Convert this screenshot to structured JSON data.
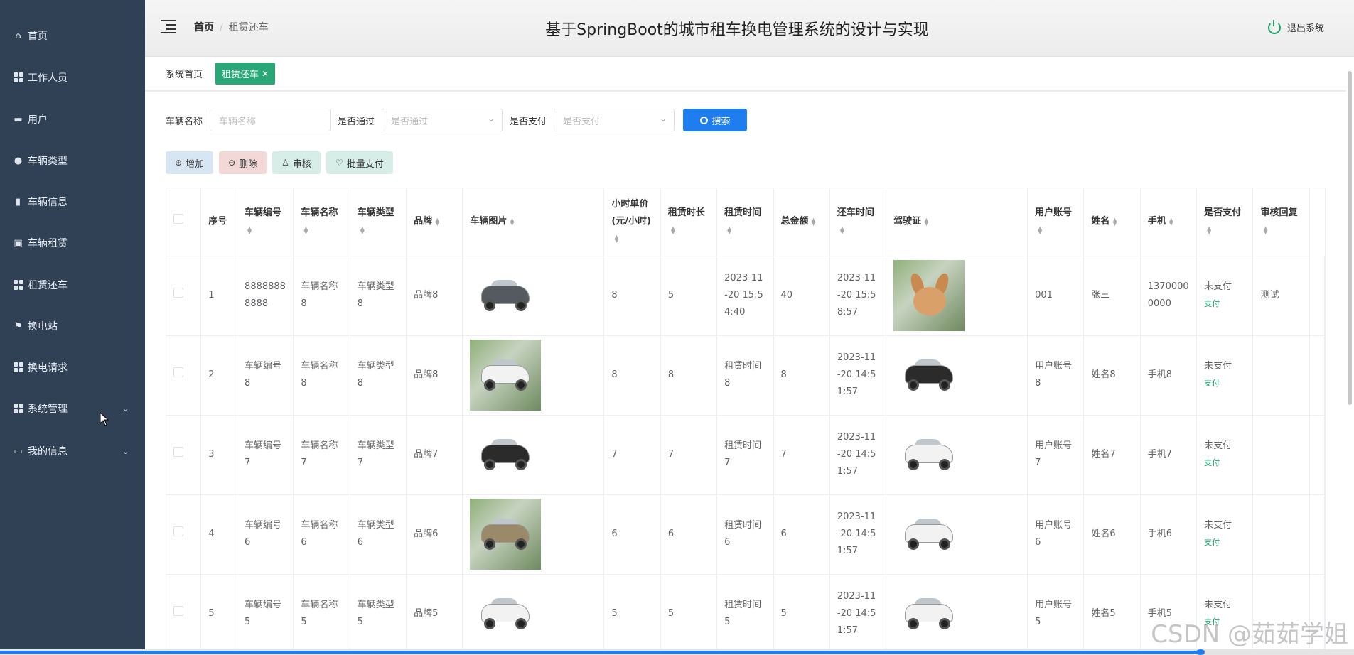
{
  "sidebar": {
    "items": [
      {
        "label": "首页",
        "icon": "home-icon"
      },
      {
        "label": "工作人员",
        "icon": "grid-icon"
      },
      {
        "label": "用户",
        "icon": "monitor-icon"
      },
      {
        "label": "车辆类型",
        "icon": "location-icon"
      },
      {
        "label": "车辆信息",
        "icon": "bar-chart-icon"
      },
      {
        "label": "车辆租赁",
        "icon": "clipboard-icon"
      },
      {
        "label": "租赁还车",
        "icon": "grid-icon"
      },
      {
        "label": "换电站",
        "icon": "flag-icon"
      },
      {
        "label": "换电请求",
        "icon": "grid-icon"
      },
      {
        "label": "系统管理",
        "icon": "grid-icon",
        "has_children": true
      },
      {
        "label": "我的信息",
        "icon": "id-card-icon",
        "has_children": true
      }
    ]
  },
  "header": {
    "breadcrumb": {
      "home": "首页",
      "separator": "/",
      "current": "租赁还车"
    },
    "title": "基于SpringBoot的城市租车换电管理系统的设计与实现",
    "logout": "退出系统"
  },
  "tags": {
    "home": "系统首页",
    "active": "租赁还车",
    "close": "✕"
  },
  "search": {
    "name_label": "车辆名称",
    "name_placeholder": "车辆名称",
    "pass_label": "是否通过",
    "pass_placeholder": "是否通过",
    "pay_label": "是否支付",
    "pay_placeholder": "是否支付",
    "button": "搜索"
  },
  "actions": {
    "add": "增加",
    "delete": "删除",
    "audit": "审核",
    "batch_pay": "批量支付"
  },
  "table": {
    "headers": [
      "序号",
      "车辆编号",
      "车辆名称",
      "车辆类型",
      "品牌",
      "车辆图片",
      "小时单价(元/小时)",
      "租赁时长",
      "租赁时间",
      "总金额",
      "还车时间",
      "驾驶证",
      "用户账号",
      "姓名",
      "手机",
      "是否支付",
      "审核回复"
    ],
    "rows": [
      {
        "index": "1",
        "vehicle_no": "88888888888",
        "vehicle_name": "车辆名称8",
        "vehicle_type": "车辆类型8",
        "brand": "品牌8",
        "image": "grey-car-image",
        "price": "8",
        "duration": "5",
        "rent_time": "2023-11-20 15:54:40",
        "total": "40",
        "return_time": "2023-11-20 15:58:57",
        "license": "rabbit-image",
        "account": "001",
        "name": "张三",
        "phone": "13700000000",
        "paid": "未支付",
        "pay_link": "支付",
        "reply": "测试"
      },
      {
        "index": "2",
        "vehicle_no": "车辆编号8",
        "vehicle_name": "车辆名称8",
        "vehicle_type": "车辆类型8",
        "brand": "品牌8",
        "image": "white-van-image",
        "price": "8",
        "duration": "8",
        "rent_time": "租赁时间8",
        "total": "8",
        "return_time": "2023-11-20 14:51:57",
        "license": "black-toy-car-image",
        "account": "用户账号8",
        "name": "姓名8",
        "phone": "手机8",
        "paid": "未支付",
        "pay_link": "支付",
        "reply": ""
      },
      {
        "index": "3",
        "vehicle_no": "车辆编号7",
        "vehicle_name": "车辆名称7",
        "vehicle_type": "车辆类型7",
        "brand": "品牌7",
        "image": "black-toy-car-image",
        "price": "7",
        "duration": "7",
        "rent_time": "租赁时间7",
        "total": "7",
        "return_time": "2023-11-20 14:51:57",
        "license": "white-mini-car-image",
        "account": "用户账号7",
        "name": "姓名7",
        "phone": "手机7",
        "paid": "未支付",
        "pay_link": "支付",
        "reply": ""
      },
      {
        "index": "4",
        "vehicle_no": "车辆编号6",
        "vehicle_name": "车辆名称6",
        "vehicle_type": "车辆类型6",
        "brand": "品牌6",
        "image": "gold-mini-car-image",
        "price": "6",
        "duration": "6",
        "rent_time": "租赁时间6",
        "total": "6",
        "return_time": "2023-11-20 14:51:57",
        "license": "white-mini-car-image",
        "account": "用户账号6",
        "name": "姓名6",
        "phone": "手机6",
        "paid": "未支付",
        "pay_link": "支付",
        "reply": ""
      },
      {
        "index": "5",
        "vehicle_no": "车辆编号5",
        "vehicle_name": "车辆名称5",
        "vehicle_type": "车辆类型5",
        "brand": "品牌5",
        "image": "white-mini-car-image",
        "price": "5",
        "duration": "5",
        "rent_time": "租赁时间5",
        "total": "5",
        "return_time": "2023-11-20 14:51:57",
        "license": "white-sports-car-image",
        "account": "用户账号5",
        "name": "姓名5",
        "phone": "手机5",
        "paid": "未支付",
        "pay_link": "支付",
        "reply": ""
      }
    ]
  },
  "watermark": "CSDN @茹茹学姐",
  "colors": {
    "sidebar": "#304156",
    "accent": "#2aa777",
    "primary": "#1e7ef0"
  }
}
